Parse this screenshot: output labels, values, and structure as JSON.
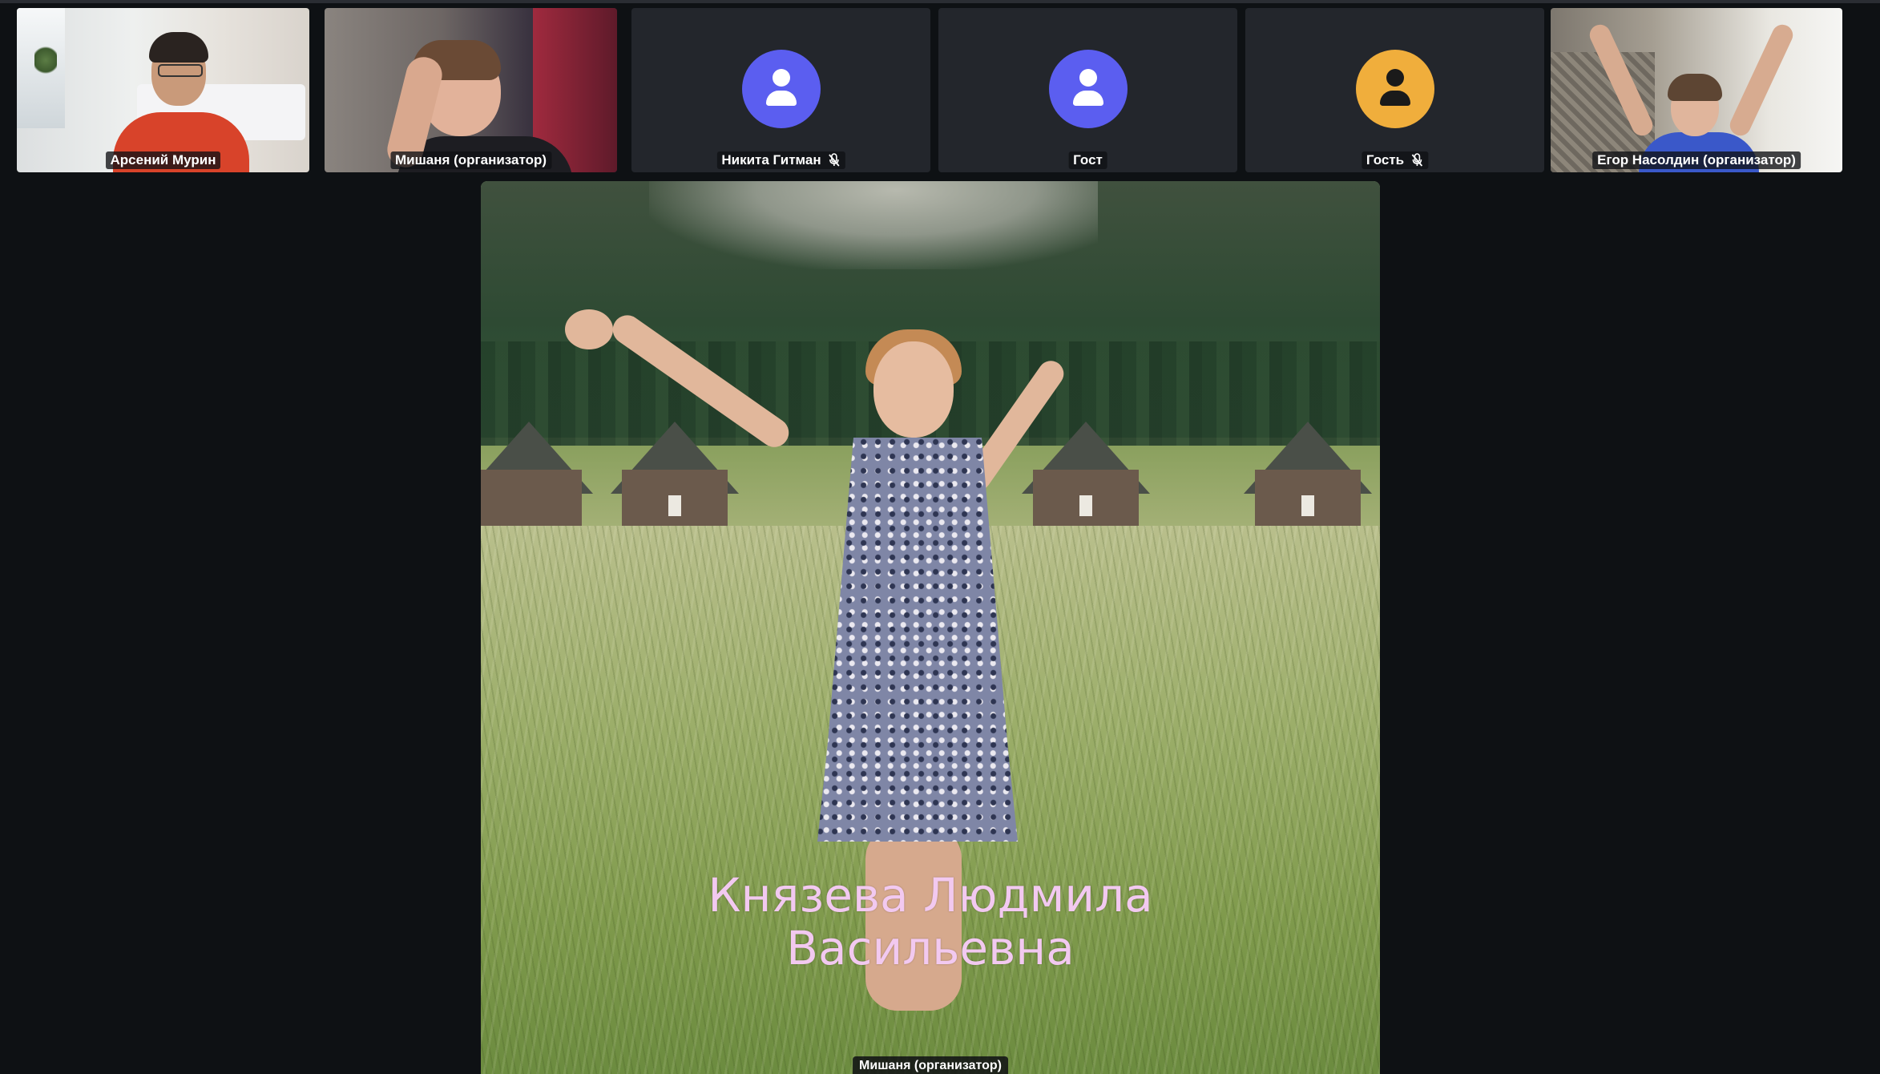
{
  "participants": [
    {
      "name": "Арсений Мурин",
      "type": "camera",
      "muted": false
    },
    {
      "name": "Мишаня (организатор)",
      "type": "camera",
      "muted": false
    },
    {
      "name": "Никита Гитман",
      "type": "avatar",
      "avatar_color": "#5b5ef0",
      "muted": true
    },
    {
      "name": "Гост",
      "type": "avatar",
      "avatar_color": "#5b5ef0",
      "muted": false
    },
    {
      "name": "Гость",
      "type": "avatar",
      "avatar_color": "#f0ae3c",
      "muted": true
    },
    {
      "name": "Егор Насолдин (организатор)",
      "type": "camera",
      "muted": false
    }
  ],
  "stage": {
    "caption_line1": "Князева Людмила",
    "caption_line2": "Васильевна",
    "presenter_name": "Мишаня (организатор)",
    "caption_color": "#f2c9f0"
  },
  "colors": {
    "background": "#0e1114",
    "tile_background": "#23262c",
    "avatar_blue": "#5b5ef0",
    "avatar_yellow": "#f0ae3c"
  }
}
